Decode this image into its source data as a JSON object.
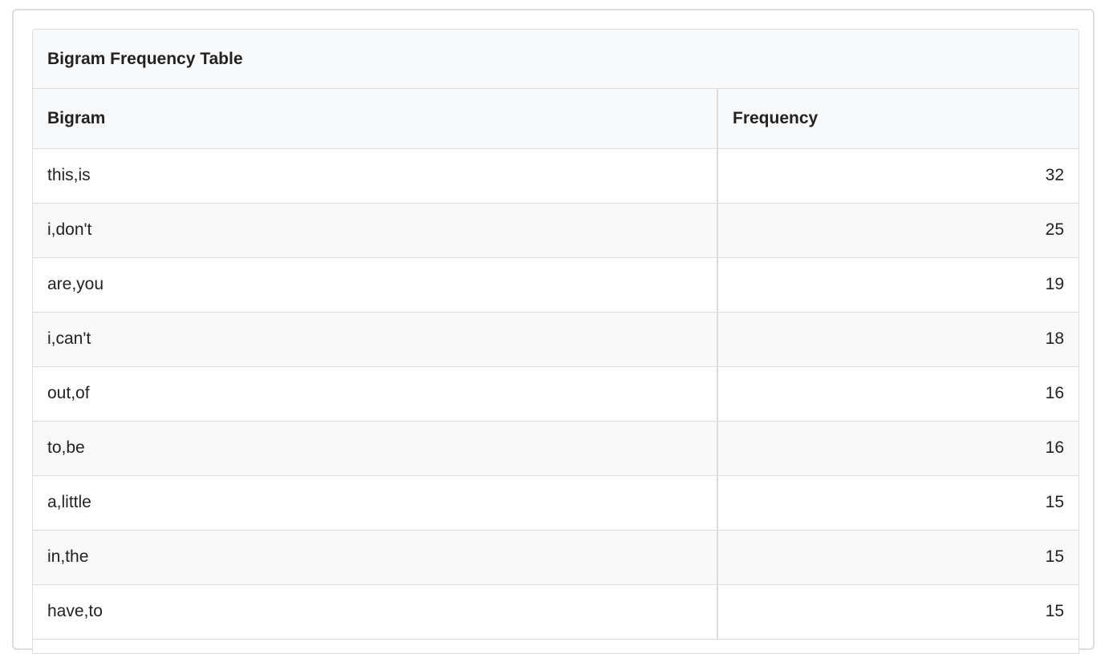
{
  "table": {
    "caption": "Bigram Frequency Table",
    "columns": [
      "Bigram",
      "Frequency"
    ],
    "rows": [
      {
        "bigram": "this,is",
        "frequency": "32"
      },
      {
        "bigram": "i,don't",
        "frequency": "25"
      },
      {
        "bigram": "are,you",
        "frequency": "19"
      },
      {
        "bigram": "i,can't",
        "frequency": "18"
      },
      {
        "bigram": "out,of",
        "frequency": "16"
      },
      {
        "bigram": "to,be",
        "frequency": "16"
      },
      {
        "bigram": "a,little",
        "frequency": "15"
      },
      {
        "bigram": "in,the",
        "frequency": "15"
      },
      {
        "bigram": "have,to",
        "frequency": "15"
      }
    ]
  },
  "colors": {
    "header_background": "#f8f9fa",
    "stripe_background": "#f8f8f8",
    "border": "#dcdcdc",
    "text": "#222222"
  }
}
